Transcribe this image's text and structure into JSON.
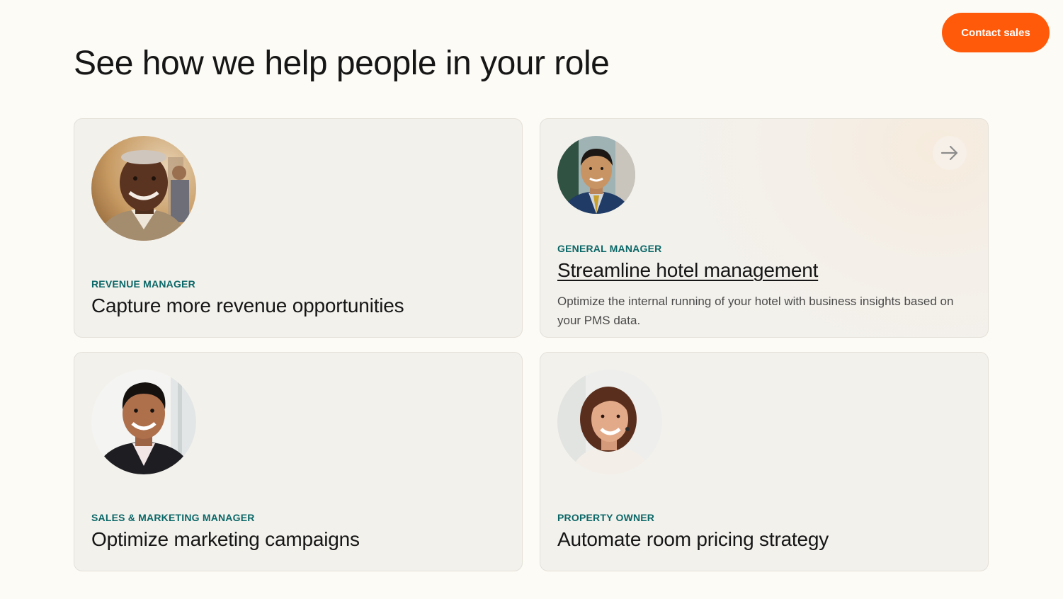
{
  "header": {
    "title": "See how we help people in your role",
    "contact_label": "Contact sales"
  },
  "cards": [
    {
      "role": "REVENUE MANAGER",
      "headline": "Capture more revenue opportunities",
      "avatar": "revenue-manager-avatar"
    },
    {
      "role": "GENERAL MANAGER",
      "headline": "Streamline hotel management",
      "description": "Optimize the internal running of your hotel with business insights based on your PMS data.",
      "avatar": "general-manager-avatar",
      "icon": "arrow-right-icon"
    },
    {
      "role": "SALES & MARKETING MANAGER",
      "headline": "Optimize marketing campaigns",
      "avatar": "sales-marketing-manager-avatar"
    },
    {
      "role": "PROPERTY OWNER",
      "headline": "Automate room pricing strategy",
      "avatar": "property-owner-avatar"
    }
  ],
  "colors": {
    "accent": "#ff5a0a",
    "role_label": "#0a6767",
    "card_bg": "#f3f1ec",
    "page_bg": "#fdfbf5"
  }
}
